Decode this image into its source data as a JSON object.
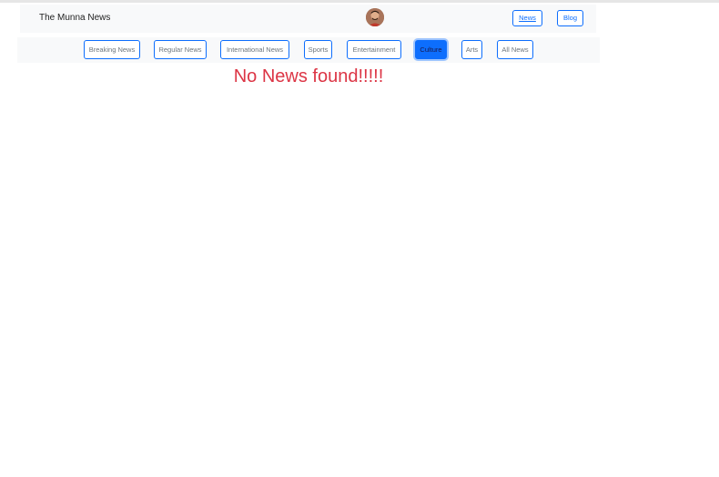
{
  "header": {
    "brand": "The Munna News",
    "avatar_icon": "user-avatar-icon",
    "nav": {
      "news_label": "News",
      "blog_label": "Blog"
    }
  },
  "categories": {
    "items": [
      {
        "label": "Breaking News",
        "active": false
      },
      {
        "label": "Regular News",
        "active": false
      },
      {
        "label": "International News",
        "active": false
      },
      {
        "label": "Sports",
        "active": false
      },
      {
        "label": "Entertainment",
        "active": false
      },
      {
        "label": "Culture",
        "active": true
      },
      {
        "label": "Arts",
        "active": false
      },
      {
        "label": "All News",
        "active": false
      }
    ]
  },
  "main": {
    "empty_message": "No News found!!!!!"
  },
  "colors": {
    "accent": "#0d6efd",
    "error": "#dc3545",
    "navbar_bg": "#f8f9fa"
  }
}
